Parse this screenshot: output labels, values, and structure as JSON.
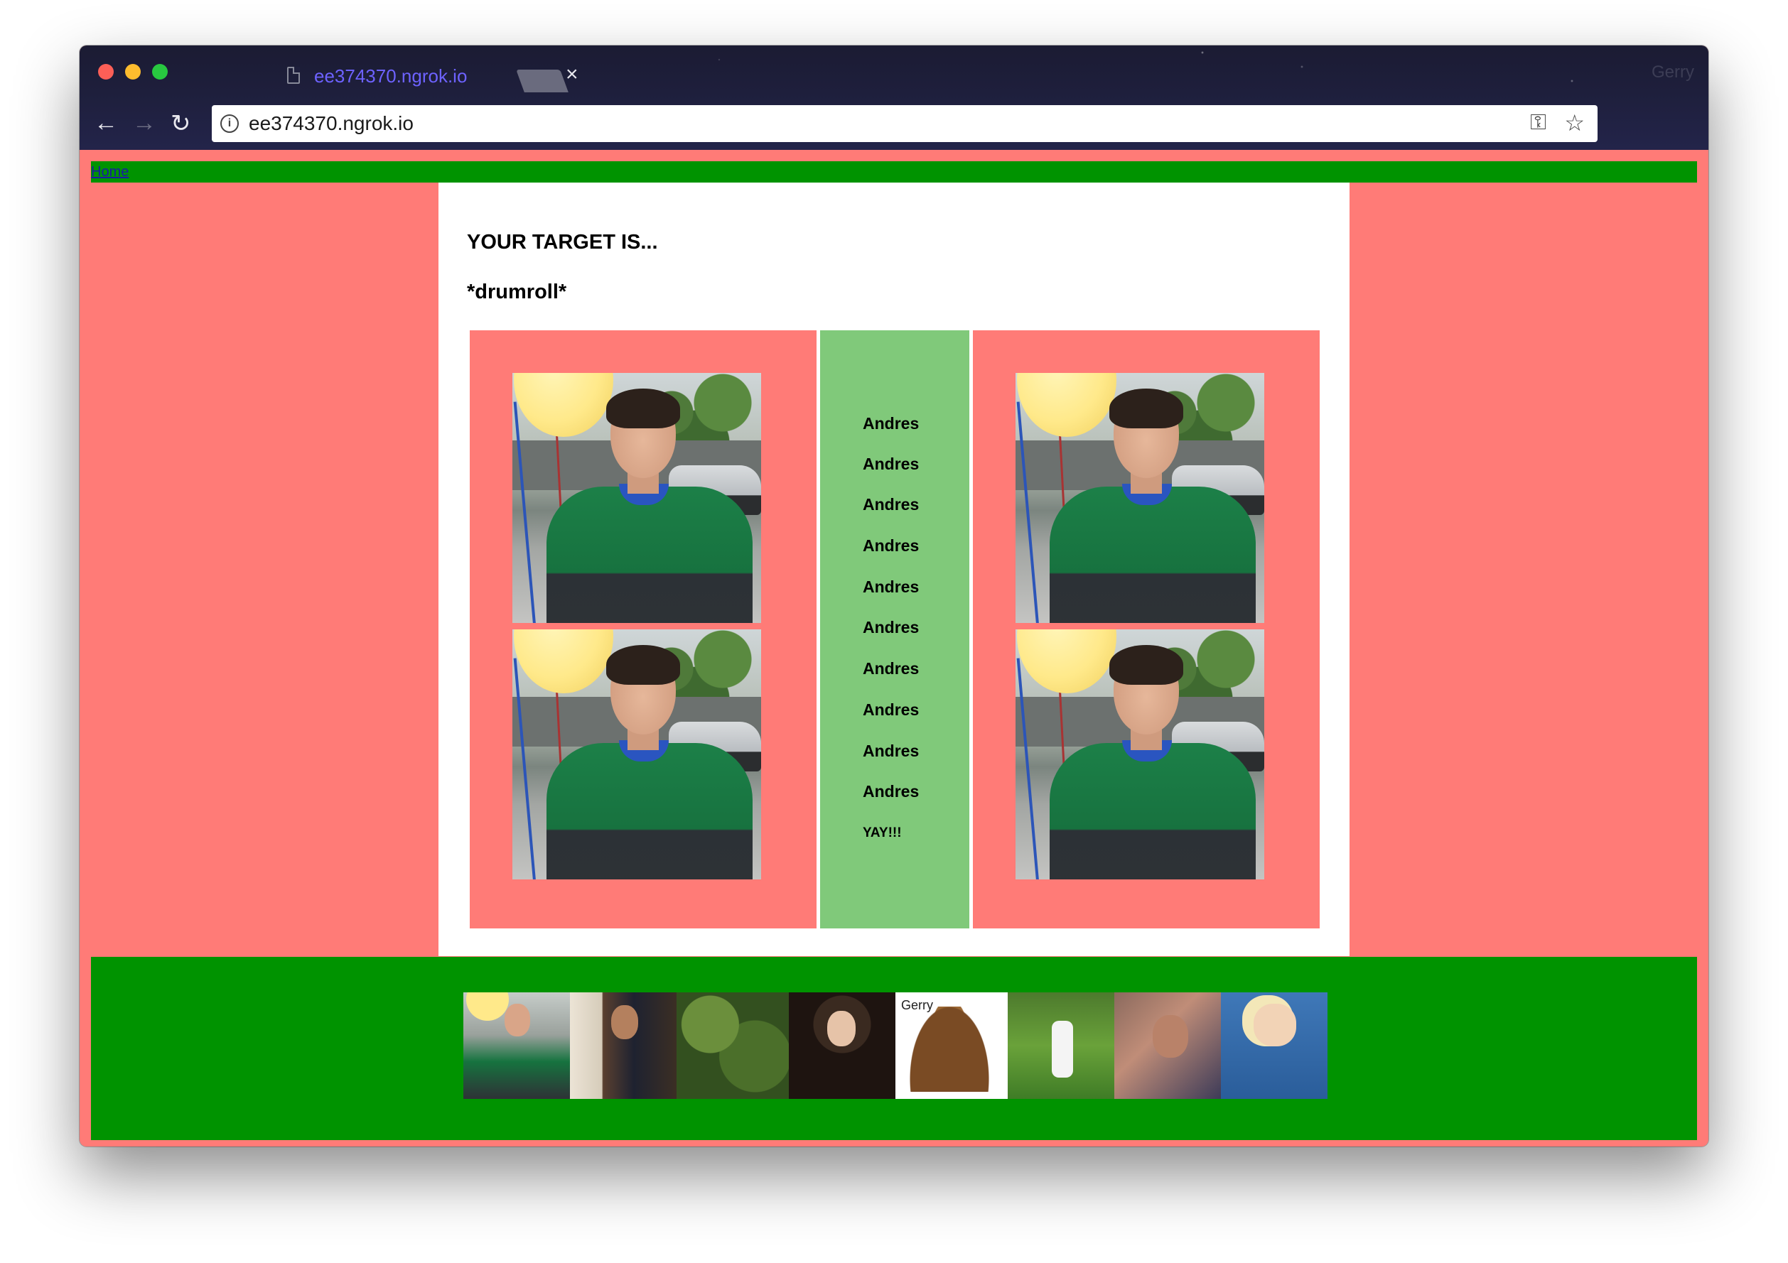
{
  "browser": {
    "tab_title": "ee374370.ngrok.io",
    "tab_close": "×",
    "profile_name": "Gerry",
    "url": "ee374370.ngrok.io",
    "nav": {
      "back": "←",
      "forward": "→",
      "reload": "↻"
    },
    "icons": {
      "page": "document-icon",
      "info": "info-icon",
      "key": "key-icon",
      "star": "star-icon",
      "menu": "more-vert-icon"
    },
    "extensions": [
      "stop-hand-icon",
      "youtube-icon",
      "no-plugin-icon",
      "face-icon",
      "lambda-icon",
      "amazon-icon",
      "card-icon",
      "moon-icon"
    ]
  },
  "page": {
    "nav_link": "Home",
    "headline": "YOUR TARGET IS...",
    "subline": "*drumroll*",
    "names": [
      "Andres",
      "Andres",
      "Andres",
      "Andres",
      "Andres",
      "Andres",
      "Andres",
      "Andres",
      "Andres",
      "Andres"
    ],
    "finale": "YAY!!!",
    "footer_thumb_caption": "Gerry"
  },
  "colors": {
    "page_background": "#ff7b77",
    "bar_green": "#009300",
    "names_column": "#80c97a",
    "panel": "#ffffff",
    "link": "#1a1aa6",
    "tab_title": "#6d62ff"
  }
}
